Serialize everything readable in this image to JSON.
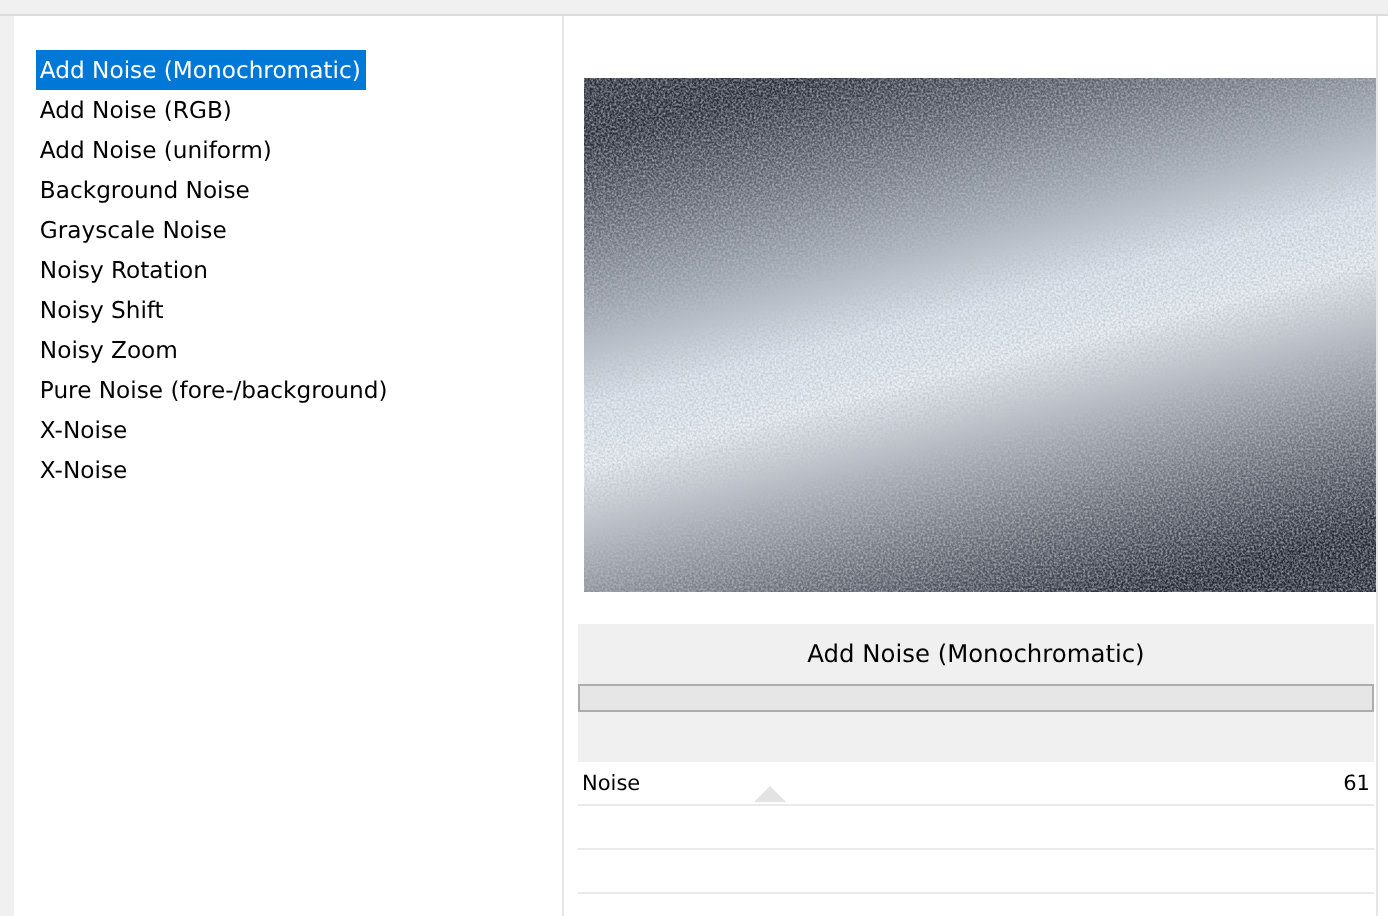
{
  "filters": [
    {
      "label": "Add Noise (Monochromatic)",
      "selected": true
    },
    {
      "label": "Add Noise (RGB)",
      "selected": false
    },
    {
      "label": "Add Noise (uniform)",
      "selected": false
    },
    {
      "label": "Background Noise",
      "selected": false
    },
    {
      "label": "Grayscale Noise",
      "selected": false
    },
    {
      "label": "Noisy Rotation",
      "selected": false
    },
    {
      "label": "Noisy Shift",
      "selected": false
    },
    {
      "label": "Noisy Zoom",
      "selected": false
    },
    {
      "label": "Pure Noise (fore-/background)",
      "selected": false
    },
    {
      "label": "X-Noise",
      "selected": false
    },
    {
      "label": "X-Noise",
      "selected": false
    }
  ],
  "settings": {
    "title": "Add Noise (Monochromatic)",
    "progress": {
      "level": 0
    },
    "parameters": [
      {
        "label": "Noise",
        "value": "61",
        "level": 0.24
      }
    ]
  }
}
